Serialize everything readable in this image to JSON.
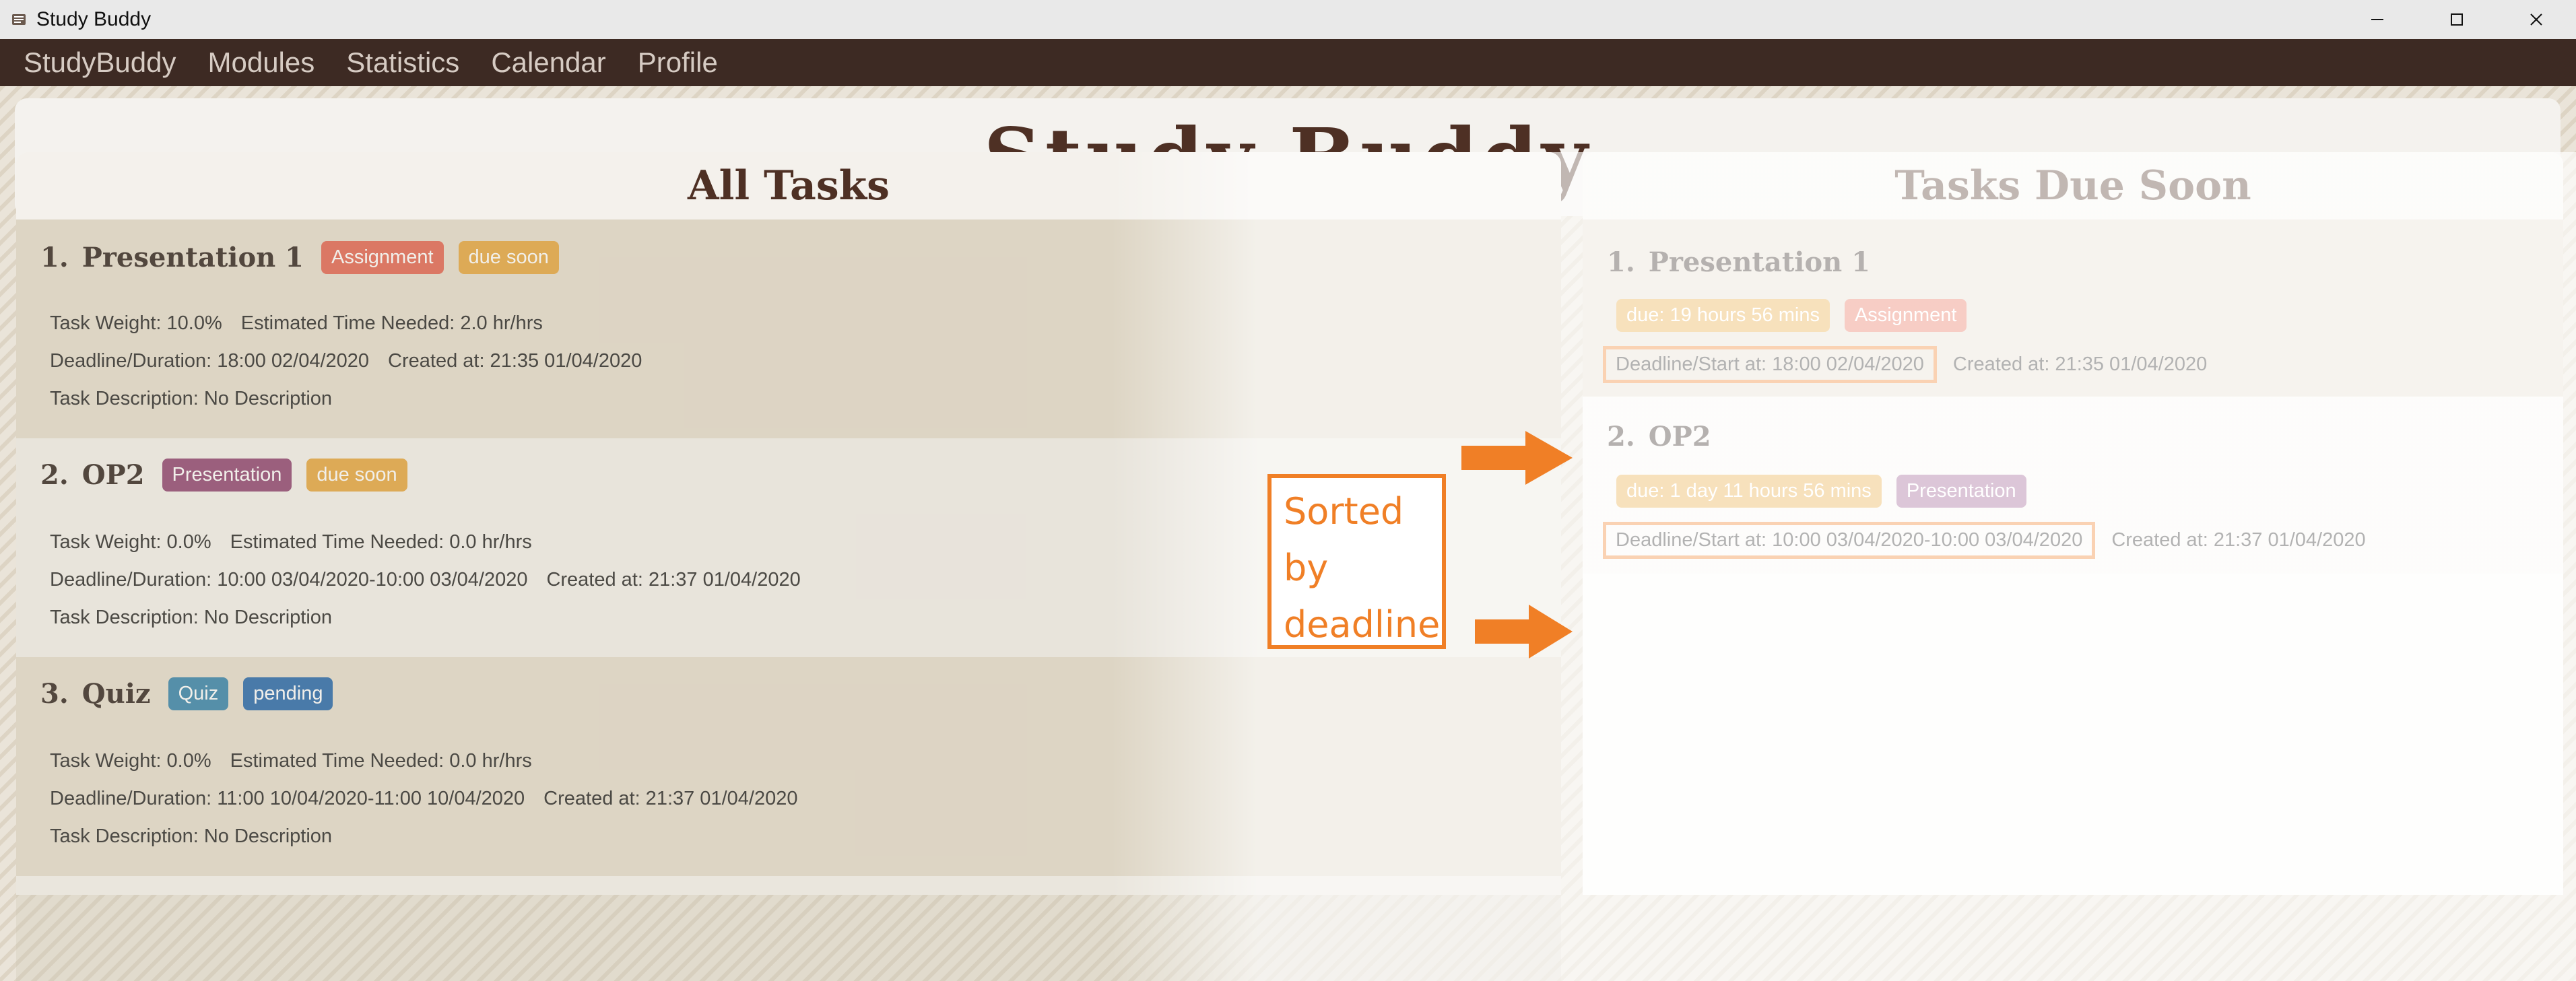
{
  "window": {
    "title": "Study Buddy"
  },
  "menu": {
    "items": [
      "StudyBuddy",
      "Modules",
      "Statistics",
      "Calendar",
      "Profile"
    ]
  },
  "header": {
    "title": "Study Buddy"
  },
  "all_tasks": {
    "title": "All Tasks",
    "tasks": [
      {
        "index": "1.",
        "name": "Presentation 1",
        "tags": [
          {
            "label": "Assignment",
            "color": "#e2614c"
          },
          {
            "label": "due soon",
            "color": "#e4a33a"
          }
        ],
        "weight": "Task Weight: 10.0%",
        "time": "Estimated Time Needed: 2.0 hr/hrs",
        "deadline": "Deadline/Duration: 18:00 02/04/2020",
        "created": "Created at: 21:35 01/04/2020",
        "description": "Task Description: No Description"
      },
      {
        "index": "2.",
        "name": "OP2",
        "tags": [
          {
            "label": "Presentation",
            "color": "#8c3f6e"
          },
          {
            "label": "due soon",
            "color": "#e4a33a"
          }
        ],
        "weight": "Task Weight: 0.0%",
        "time": "Estimated Time Needed: 0.0 hr/hrs",
        "deadline": "Deadline/Duration: 10:00 03/04/2020-10:00 03/04/2020",
        "created": "Created at: 21:37 01/04/2020",
        "description": "Task Description: No Description"
      },
      {
        "index": "3.",
        "name": "Quiz",
        "tags": [
          {
            "label": "Quiz",
            "color": "#2f7fa8"
          },
          {
            "label": "pending",
            "color": "#1f63a8"
          }
        ],
        "weight": "Task Weight: 0.0%",
        "time": "Estimated Time Needed: 0.0 hr/hrs",
        "deadline": "Deadline/Duration: 11:00 10/04/2020-11:00 10/04/2020",
        "created": "Created at: 21:37 01/04/2020",
        "description": "Task Description: No Description"
      }
    ]
  },
  "due_soon": {
    "title": "Tasks Due Soon",
    "tasks": [
      {
        "index": "1.",
        "name": "Presentation 1",
        "due": {
          "label": "due: 19 hours 56 mins",
          "color": "#e9a93f"
        },
        "type": {
          "label": "Assignment",
          "color": "#e96f5a"
        },
        "deadline": "Deadline/Start at: 18:00 02/04/2020",
        "created": "Created at: 21:35 01/04/2020"
      },
      {
        "index": "2.",
        "name": "OP2",
        "due": {
          "label": "due: 1 day 11 hours 56 mins",
          "color": "#e9a93f"
        },
        "type": {
          "label": "Presentation",
          "color": "#9b5b8e"
        },
        "deadline": "Deadline/Start at: 10:00 03/04/2020-10:00 03/04/2020",
        "created": "Created at: 21:37 01/04/2020"
      }
    ]
  },
  "annotation": {
    "lines": [
      "Sorted",
      "by",
      "deadline"
    ],
    "color": "#f07f26"
  },
  "colors": {
    "menubar": "#3d2a23",
    "brand_brown": "#4e3024",
    "accent_orange": "#f07f26"
  }
}
